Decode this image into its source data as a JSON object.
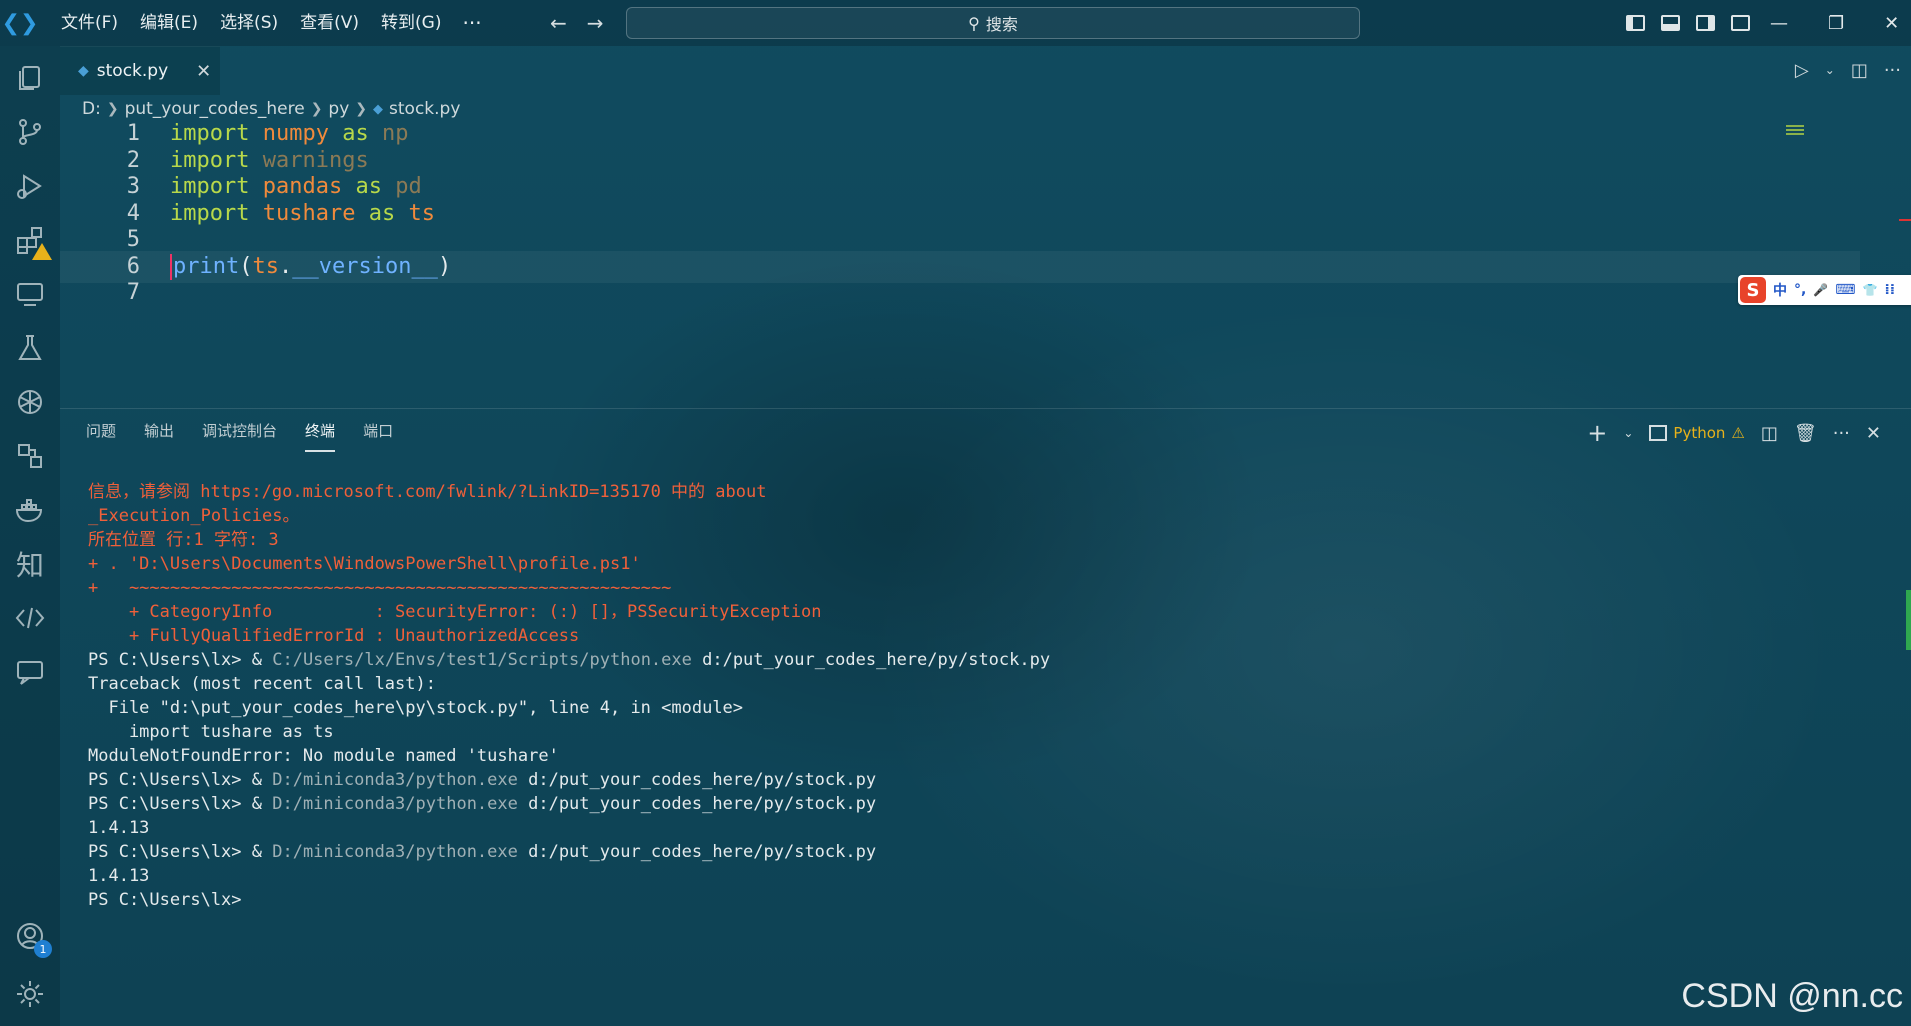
{
  "titlebar": {
    "menu": [
      "文件(F)",
      "编辑(E)",
      "选择(S)",
      "查看(V)",
      "转到(G)"
    ],
    "more": "···",
    "search_placeholder": "搜索"
  },
  "tab": {
    "name": "stock.py",
    "close": "✕"
  },
  "breadcrumb": [
    "D:",
    "put_your_codes_here",
    "py",
    "stock.py"
  ],
  "code": {
    "lines": [
      {
        "n": "1",
        "tokens": [
          [
            "import",
            "kw"
          ],
          [
            " ",
            ""
          ],
          [
            "numpy",
            "mod"
          ],
          [
            " ",
            ""
          ],
          [
            "as",
            "kw"
          ],
          [
            " ",
            ""
          ],
          [
            "np",
            "dim"
          ]
        ]
      },
      {
        "n": "2",
        "tokens": [
          [
            "import",
            "kw"
          ],
          [
            " ",
            ""
          ],
          [
            "warnings",
            "dim"
          ]
        ]
      },
      {
        "n": "3",
        "tokens": [
          [
            "import",
            "kw"
          ],
          [
            " ",
            ""
          ],
          [
            "pandas",
            "mod"
          ],
          [
            " ",
            ""
          ],
          [
            "as",
            "kw"
          ],
          [
            " ",
            ""
          ],
          [
            "pd",
            "dim"
          ]
        ]
      },
      {
        "n": "4",
        "tokens": [
          [
            "import",
            "kw"
          ],
          [
            " ",
            ""
          ],
          [
            "tushare",
            "mod"
          ],
          [
            " ",
            ""
          ],
          [
            "as",
            "kw"
          ],
          [
            " ",
            ""
          ],
          [
            "ts",
            "mod"
          ]
        ]
      },
      {
        "n": "5",
        "tokens": []
      },
      {
        "n": "6",
        "tokens": [
          [
            "print",
            "fn"
          ],
          [
            "(",
            "norm"
          ],
          [
            "ts",
            "mod"
          ],
          [
            ".",
            "norm"
          ],
          [
            "__version__",
            "fn"
          ],
          [
            ")",
            "norm"
          ]
        ]
      },
      {
        "n": "7",
        "tokens": []
      }
    ]
  },
  "ime": {
    "logo": "S",
    "mode": "中",
    "punct": "°,",
    "mic": "🎤",
    "keyboard": "⌨",
    "skin": "👕",
    "menu": "⁞⁞"
  },
  "panel": {
    "tabs": [
      "问题",
      "输出",
      "调试控制台",
      "终端",
      "端口"
    ],
    "active_tab": "终端",
    "terminal_profile": "Python"
  },
  "terminal": [
    {
      "t": "信息，请参阅 https:/go.microsoft.com/fwlink/?LinkID=135170 中的 about",
      "c": "err"
    },
    {
      "t": "_Execution_Policies。",
      "c": "err"
    },
    {
      "t": "所在位置 行:1 字符: 3",
      "c": "err"
    },
    {
      "t": "+ . 'D:\\Users\\Documents\\WindowsPowerShell\\profile.ps1'",
      "c": "err"
    },
    {
      "t": "+   ~~~~~~~~~~~~~~~~~~~~~~~~~~~~~~~~~~~~~~~~~~~~~~~~~~~~~",
      "c": "err"
    },
    {
      "t": "    + CategoryInfo          : SecurityError: (:) []，PSSecurityException",
      "c": "err"
    },
    {
      "t": "    + FullyQualifiedErrorId : UnauthorizedAccess",
      "c": "err"
    },
    {
      "t": "PS C:\\Users\\lx> & C:/Users/lx/Envs/test1/Scripts/python.exe d:/put_your_codes_here/py/stock.py",
      "c": "norm"
    },
    {
      "t": "Traceback (most recent call last):",
      "c": "norm"
    },
    {
      "t": "  File \"d:\\put_your_codes_here\\py\\stock.py\", line 4, in <module>",
      "c": "norm"
    },
    {
      "t": "    import tushare as ts",
      "c": "norm"
    },
    {
      "t": "ModuleNotFoundError: No module named 'tushare'",
      "c": "norm"
    },
    {
      "t": "PS C:\\Users\\lx> & D:/miniconda3/python.exe d:/put_your_codes_here/py/stock.py",
      "c": "norm"
    },
    {
      "t": "PS C:\\Users\\lx> & D:/miniconda3/python.exe d:/put_your_codes_here/py/stock.py",
      "c": "norm"
    },
    {
      "t": "1.4.13",
      "c": "norm"
    },
    {
      "t": "PS C:\\Users\\lx> & D:/miniconda3/python.exe d:/put_your_codes_here/py/stock.py",
      "c": "norm"
    },
    {
      "t": "1.4.13",
      "c": "norm"
    },
    {
      "t": "PS C:\\Users\\lx>",
      "c": "norm"
    }
  ],
  "account_badge": "1",
  "watermark": "CSDN @nn.cc",
  "colors": {
    "keyword": "#b8d84a",
    "module": "#f08a3c",
    "error": "#f0603a",
    "warning": "#e8b21a"
  }
}
